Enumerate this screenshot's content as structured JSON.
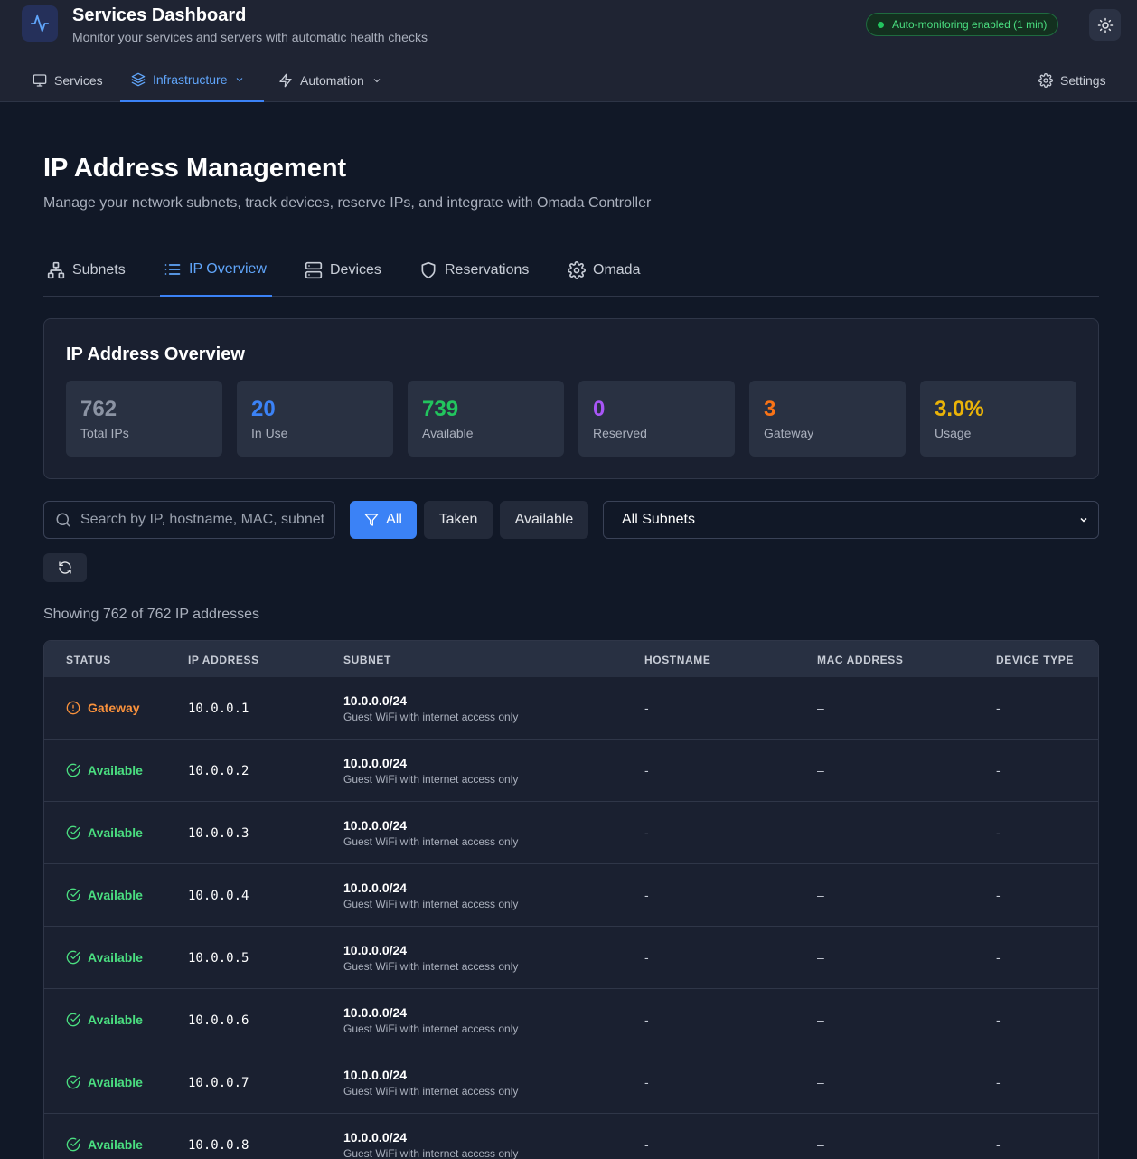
{
  "header": {
    "title": "Services Dashboard",
    "subtitle": "Monitor your services and servers with automatic health checks",
    "monitoring_badge": "Auto-monitoring enabled (1 min)"
  },
  "nav": {
    "services": "Services",
    "infrastructure": "Infrastructure",
    "automation": "Automation",
    "settings": "Settings"
  },
  "page": {
    "title": "IP Address Management",
    "subtitle": "Manage your network subnets, track devices, reserve IPs, and integrate with Omada Controller"
  },
  "subtabs": {
    "subnets": "Subnets",
    "ip_overview": "IP Overview",
    "devices": "Devices",
    "reservations": "Reservations",
    "omada": "Omada"
  },
  "overview": {
    "title": "IP Address Overview",
    "stats": [
      {
        "value": "762",
        "label": "Total IPs",
        "color": "#8b93a3"
      },
      {
        "value": "20",
        "label": "In Use",
        "color": "#3b82f6"
      },
      {
        "value": "739",
        "label": "Available",
        "color": "#22c55e"
      },
      {
        "value": "0",
        "label": "Reserved",
        "color": "#a855f7"
      },
      {
        "value": "3",
        "label": "Gateway",
        "color": "#f97316"
      },
      {
        "value": "3.0%",
        "label": "Usage",
        "color": "#eab308"
      }
    ]
  },
  "filters": {
    "search_placeholder": "Search by IP, hostname, MAC, subnet...",
    "all": "All",
    "taken": "Taken",
    "available": "Available",
    "subnet_select": "All Subnets"
  },
  "showing": "Showing 762 of 762 IP addresses",
  "table": {
    "headers": [
      "STATUS",
      "IP ADDRESS",
      "SUBNET",
      "HOSTNAME",
      "MAC ADDRESS",
      "DEVICE TYPE"
    ],
    "rows": [
      {
        "status": "Gateway",
        "ip": "10.0.0.1",
        "subnet": "10.0.0.0/24",
        "subnet_desc": "Guest WiFi with internet access only",
        "hostname": "-",
        "mac": "–",
        "device_type": "-"
      },
      {
        "status": "Available",
        "ip": "10.0.0.2",
        "subnet": "10.0.0.0/24",
        "subnet_desc": "Guest WiFi with internet access only",
        "hostname": "-",
        "mac": "–",
        "device_type": "-"
      },
      {
        "status": "Available",
        "ip": "10.0.0.3",
        "subnet": "10.0.0.0/24",
        "subnet_desc": "Guest WiFi with internet access only",
        "hostname": "-",
        "mac": "–",
        "device_type": "-"
      },
      {
        "status": "Available",
        "ip": "10.0.0.4",
        "subnet": "10.0.0.0/24",
        "subnet_desc": "Guest WiFi with internet access only",
        "hostname": "-",
        "mac": "–",
        "device_type": "-"
      },
      {
        "status": "Available",
        "ip": "10.0.0.5",
        "subnet": "10.0.0.0/24",
        "subnet_desc": "Guest WiFi with internet access only",
        "hostname": "-",
        "mac": "–",
        "device_type": "-"
      },
      {
        "status": "Available",
        "ip": "10.0.0.6",
        "subnet": "10.0.0.0/24",
        "subnet_desc": "Guest WiFi with internet access only",
        "hostname": "-",
        "mac": "–",
        "device_type": "-"
      },
      {
        "status": "Available",
        "ip": "10.0.0.7",
        "subnet": "10.0.0.0/24",
        "subnet_desc": "Guest WiFi with internet access only",
        "hostname": "-",
        "mac": "–",
        "device_type": "-"
      },
      {
        "status": "Available",
        "ip": "10.0.0.8",
        "subnet": "10.0.0.0/24",
        "subnet_desc": "Guest WiFi with internet access only",
        "hostname": "-",
        "mac": "–",
        "device_type": "-"
      }
    ]
  }
}
